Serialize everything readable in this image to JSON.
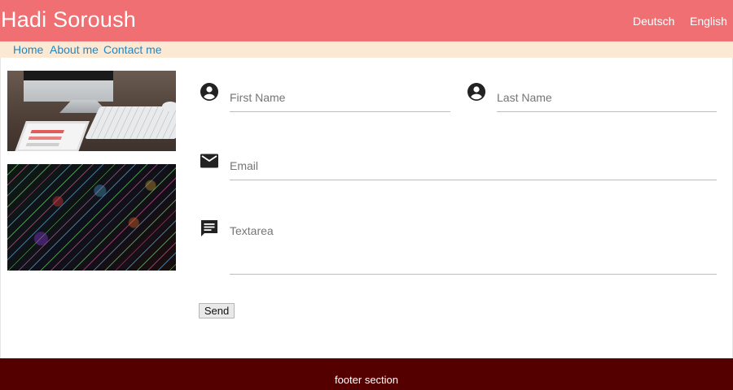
{
  "header": {
    "brand": "Hadi Soroush",
    "languages": [
      "Deutsch",
      "English"
    ],
    "background_color": "#ef6f72"
  },
  "nav": {
    "items": [
      "Home",
      "About me",
      "Contact me"
    ],
    "background_color": "#fbe9d3",
    "link_color": "#1e88c9"
  },
  "images": [
    {
      "icon": "desk-workspace-photo"
    },
    {
      "icon": "colorful-lines-photo"
    }
  ],
  "form": {
    "first_name": {
      "placeholder": "First Name",
      "value": "",
      "icon": "account-circle-icon"
    },
    "last_name": {
      "placeholder": "Last Name",
      "value": "",
      "icon": "account-circle-icon"
    },
    "email": {
      "placeholder": "Email",
      "value": "",
      "icon": "mail-icon"
    },
    "textarea": {
      "placeholder": "Textarea",
      "value": "",
      "icon": "message-icon"
    },
    "send_label": "Send"
  },
  "footer": {
    "text": "footer section",
    "background_color": "#540001"
  }
}
